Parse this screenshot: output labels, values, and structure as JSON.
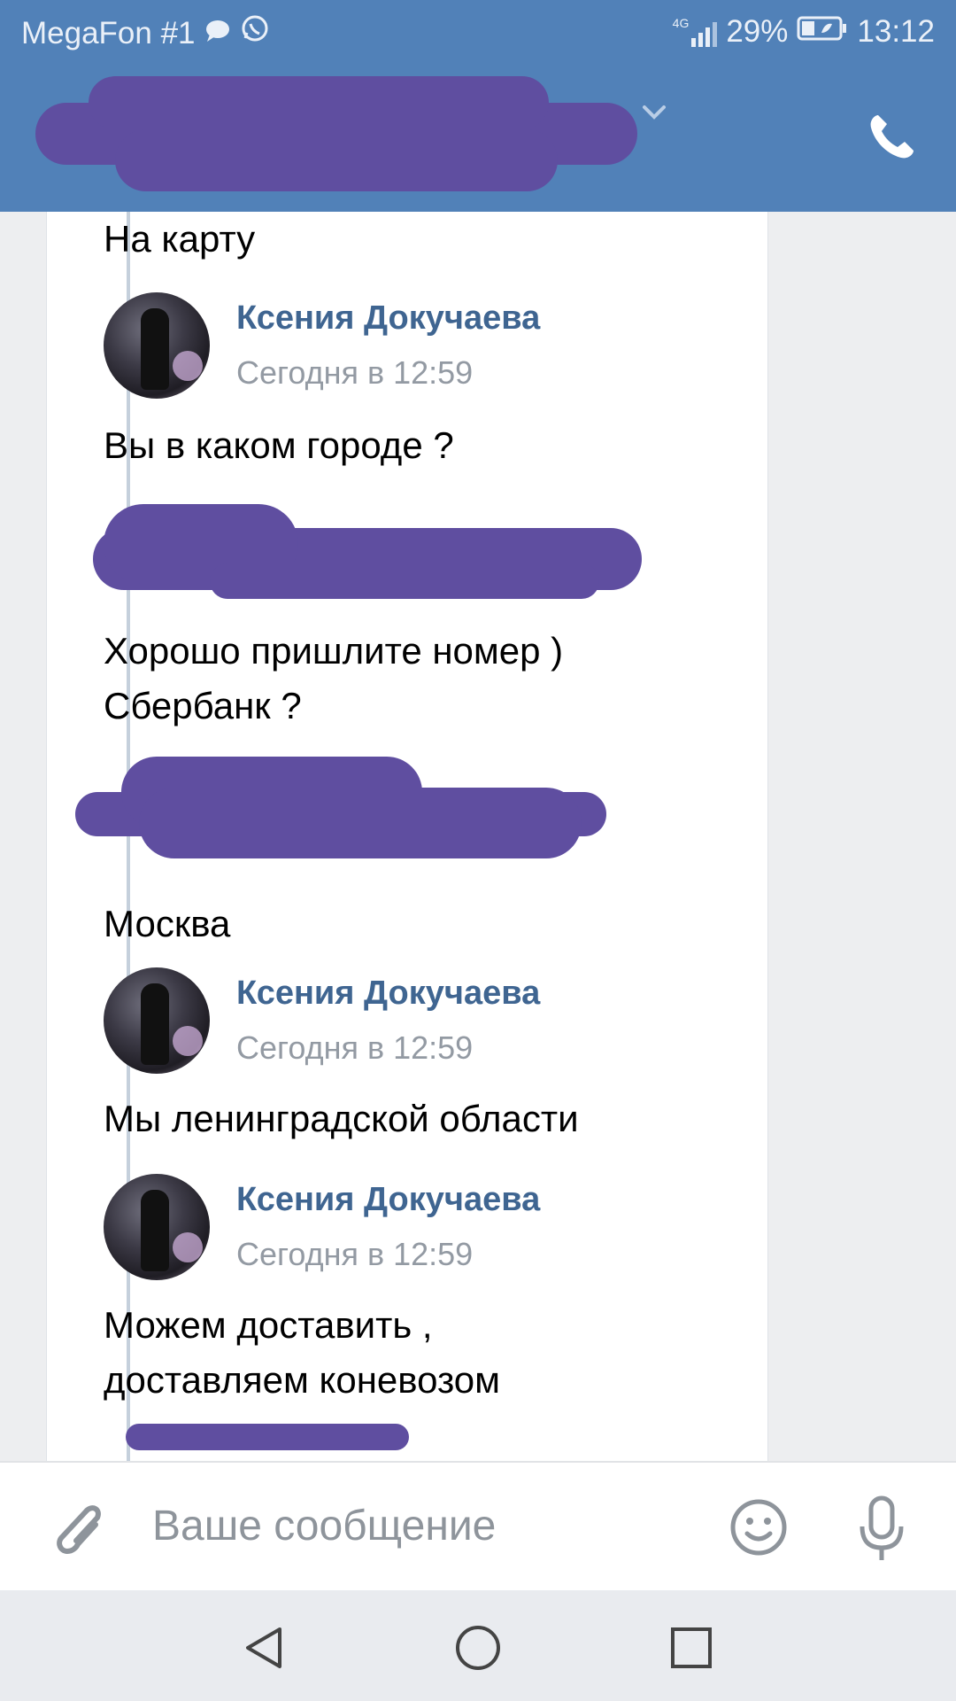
{
  "status_bar": {
    "carrier": "MegaFon #1",
    "network": "4G",
    "battery": "29%",
    "time": "13:12"
  },
  "header": {
    "title_redacted": true
  },
  "messages": [
    {
      "type": "text",
      "text": "На карту"
    },
    {
      "type": "author",
      "name": "Ксения Докучаева",
      "time": "Сегодня в 12:59"
    },
    {
      "type": "text",
      "text": "Вы в каком городе ?"
    },
    {
      "type": "author_redacted"
    },
    {
      "type": "text",
      "lines": [
        "Хорошо пришлите номер )",
        "Сбербанк ?"
      ]
    },
    {
      "type": "author_redacted"
    },
    {
      "type": "text",
      "text": "Москва"
    },
    {
      "type": "author",
      "name": "Ксения Докучаева",
      "time": "Сегодня в 12:59"
    },
    {
      "type": "text",
      "text": "Мы ленинградской  области"
    },
    {
      "type": "author",
      "name": "Ксения Докучаева",
      "time": "Сегодня в 12:59"
    },
    {
      "type": "text",
      "lines": [
        "Можем доставить ,",
        "доставляем коневозом"
      ]
    },
    {
      "type": "author_redacted"
    }
  ],
  "composer": {
    "placeholder": "Ваше сообщение"
  },
  "icons": [
    "chat-bubble-icon",
    "whatsapp-icon",
    "signal-icon",
    "battery-icon",
    "chevron-down-icon",
    "phone-icon",
    "attachment-icon",
    "emoji-icon",
    "microphone-icon",
    "back-icon",
    "home-icon",
    "recents-icon"
  ],
  "colors": {
    "header_bg": "#5181b8",
    "author_name": "#3f6591",
    "redaction": "#5f4ea0"
  }
}
